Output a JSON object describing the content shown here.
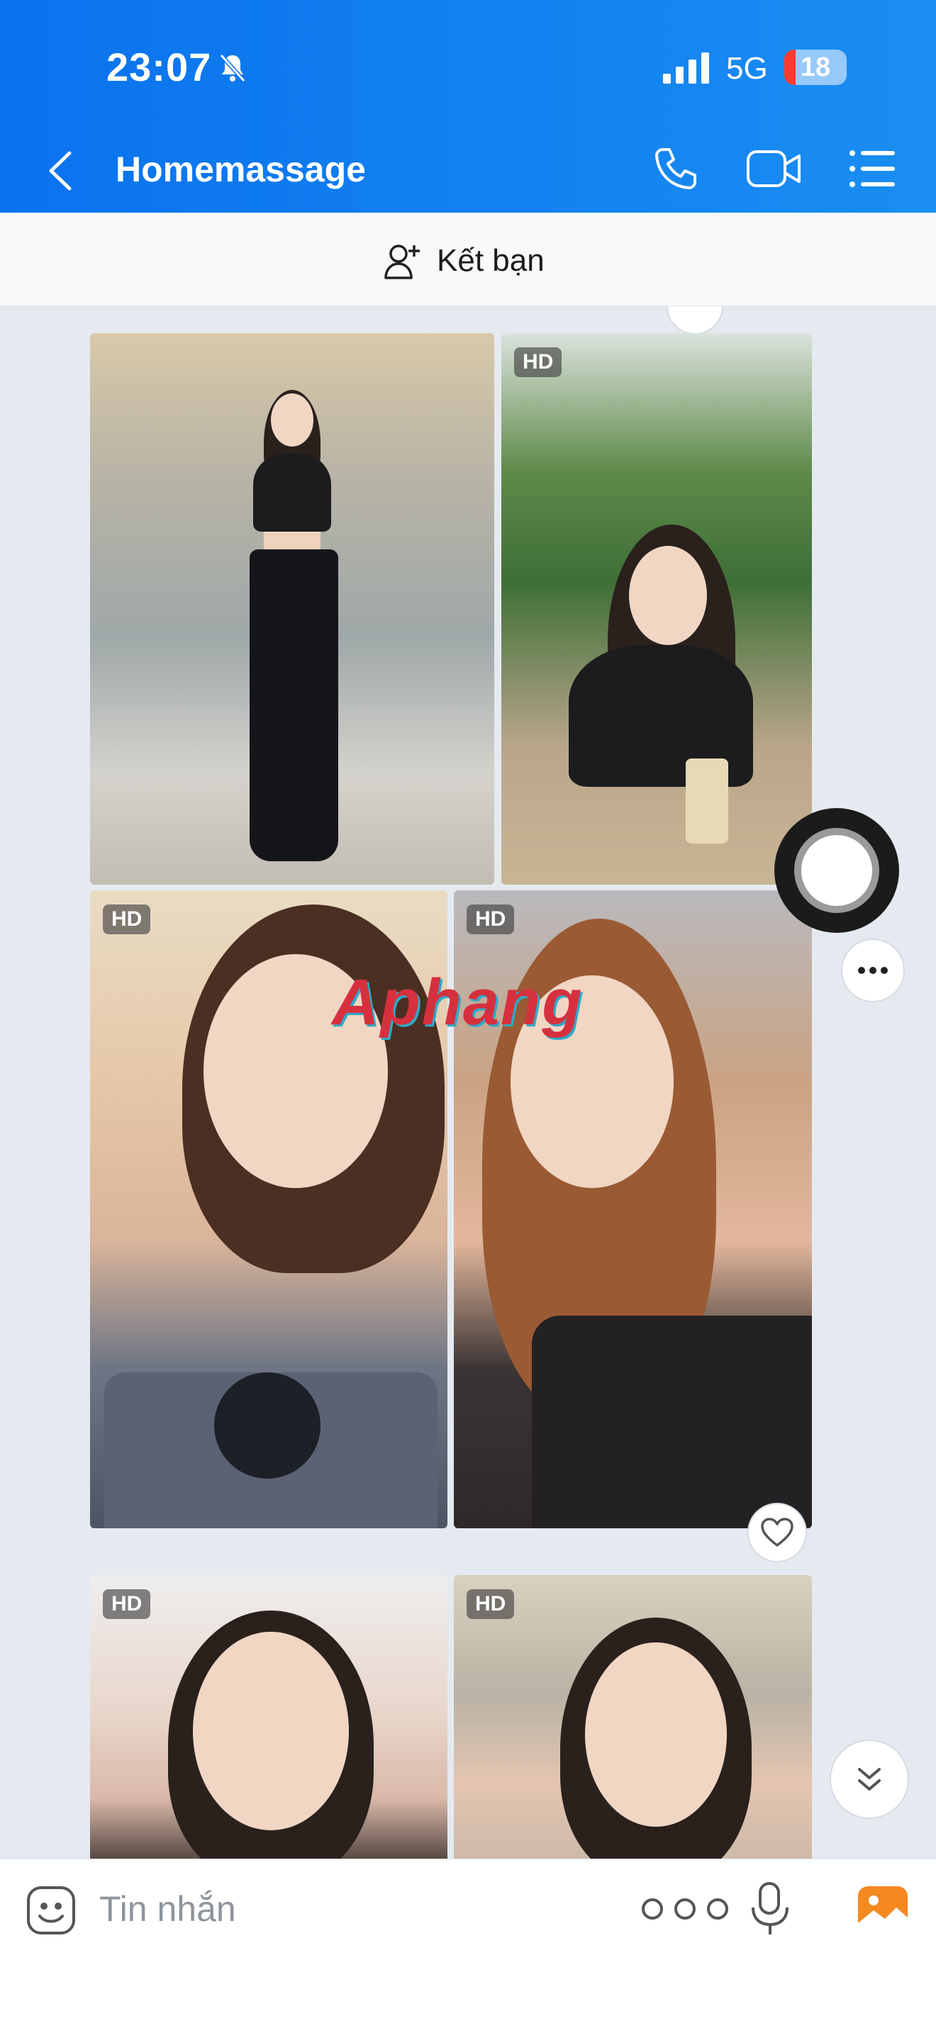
{
  "status_bar": {
    "time": "23:07",
    "network": "5G",
    "battery": "18",
    "battery_level": 0.18,
    "icons": [
      "bell-slash-icon",
      "signal-icon"
    ]
  },
  "header": {
    "title": "Homemassage",
    "actions": [
      "back-icon",
      "phone-icon",
      "video-icon",
      "list-icon"
    ]
  },
  "friend_bar": {
    "label": "Kết bạn",
    "icon": "add-friend-icon"
  },
  "chat": {
    "photos": [
      {
        "hd": ""
      },
      {
        "hd": "HD"
      },
      {
        "hd": "HD"
      },
      {
        "hd": "HD"
      },
      {
        "hd": "HD"
      },
      {
        "hd": "HD"
      }
    ],
    "watermark": "Aphang",
    "buttons": [
      "heart-icon",
      "more-icon",
      "chevron-double-down-icon"
    ]
  },
  "composer": {
    "placeholder": "Tin nhắn",
    "icons": [
      "sticker-icon",
      "more-dots-icon",
      "voice-text-icon",
      "gallery-icon"
    ]
  },
  "colors": {
    "header_start": "#0a72ee",
    "header_end": "#1a8ef2",
    "battery_low": "#ff3b30",
    "chat_bg": "#e5eaf0",
    "gallery_accent": "#f4891f"
  }
}
